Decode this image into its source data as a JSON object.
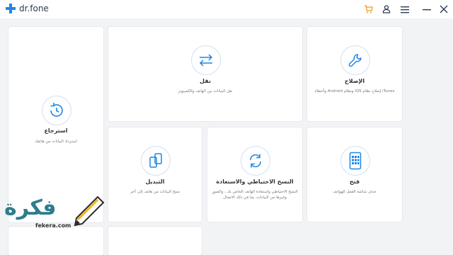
{
  "app": {
    "name": "dr.fone"
  },
  "colors": {
    "accent": "#1f86e6",
    "cart": "#f29b1e",
    "background": "#f2f3f5"
  },
  "titlebar": {
    "icons": [
      "cart-icon",
      "user-icon",
      "menu-icon",
      "minimize-icon",
      "close-icon"
    ]
  },
  "cards": {
    "restore": {
      "title": "استرجاع",
      "desc": "استرداد البيانات من هاتفك"
    },
    "transfer": {
      "title": "نقل",
      "desc": "نقل البيانات بين الهاتف والكمبيوتر"
    },
    "repair": {
      "title": "الإصلاح",
      "desc": "وأخطاء Android ونظام iOS إصلاح نظام iTunes"
    },
    "switch": {
      "title": "التبديل",
      "desc": "نسخ البيانات من هاتف إلى آخر"
    },
    "backup": {
      "title": "النسخ الاحتياطي والاستعادة",
      "desc": "النسخ الاحتياطي واستعادة الهاتف الخاص بك ، والصور وغيرها من البيانات، بما في ذلك الاتصال"
    },
    "unlock": {
      "title": "فتح",
      "desc": "حذف شاشة القفل للهواتف"
    }
  },
  "watermark": {
    "text": "فكرة",
    "url": "fekera.com"
  }
}
